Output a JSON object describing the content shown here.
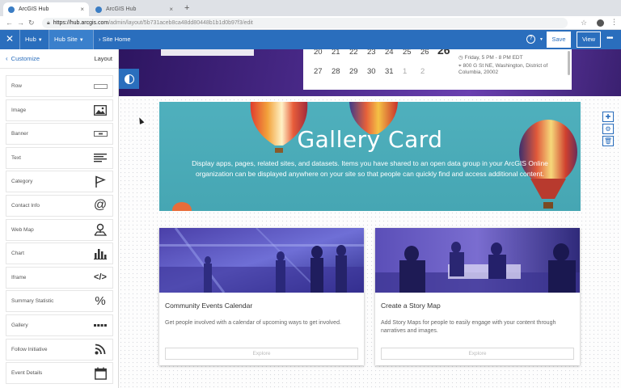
{
  "browser": {
    "tabs": [
      {
        "label": "ArcGIS Hub",
        "active": true
      },
      {
        "label": "ArcGIS Hub",
        "active": false
      }
    ],
    "url_host": "https://hub.arcgis.com",
    "url_path": "/admin/layout/5b731aceb8ca48dd80448b1b1d0b97f3/edit"
  },
  "hub_header": {
    "hub_label": "Hub",
    "hub_site_label": "Hub Site",
    "site_home_label": "Site Home",
    "save_label": "Save",
    "view_label": "View",
    "accent_color": "#2a6ebd"
  },
  "sidebar": {
    "back_label": "Customize",
    "layout_label": "Layout",
    "cards": [
      {
        "label": "Row",
        "icon": "row-icon"
      },
      {
        "label": "Image",
        "icon": "image-icon"
      },
      {
        "label": "Banner",
        "icon": "banner-icon"
      },
      {
        "label": "Text",
        "icon": "text-lines-icon"
      },
      {
        "label": "Category",
        "icon": "flag-icon"
      },
      {
        "label": "Contact Info",
        "icon": "at-icon"
      },
      {
        "label": "Web Map",
        "icon": "map-pin-icon"
      },
      {
        "label": "Chart",
        "icon": "bar-chart-icon"
      },
      {
        "label": "Iframe",
        "icon": "code-icon"
      },
      {
        "label": "Summary Statistic",
        "icon": "percent-icon"
      },
      {
        "label": "Gallery",
        "icon": "gallery-dots-icon"
      },
      {
        "label": "Follow Initiative",
        "icon": "rss-icon"
      },
      {
        "label": "Event Details",
        "icon": "calendar-icon"
      }
    ]
  },
  "calendar": {
    "row1": [
      "20",
      "21",
      "22",
      "23",
      "24",
      "25",
      "26"
    ],
    "row2": [
      "27",
      "28",
      "29",
      "30",
      "31",
      "1",
      "2"
    ],
    "big_day": "26",
    "event_time": "Friday, 5 PM - 8 PM EDT",
    "event_address_1": "800 G St NE, Washington, District of",
    "event_address_2": "Columbia, 20002"
  },
  "gallery_card": {
    "title": "Gallery Card",
    "description": "Display apps, pages, related sites, and datasets. Items you have shared to an open data group in your ArcGIS Online organization can be displayed anywhere on your site so that people can quickly find and access additional content."
  },
  "cards": [
    {
      "title": "Community Events Calendar",
      "description": "Get people involved with a calendar of upcoming ways to get involved.",
      "button": "Explore"
    },
    {
      "title": "Create a Story Map",
      "description": "Add Story Maps for people to easily engage with your content through narratives and images.",
      "button": "Explore"
    }
  ]
}
